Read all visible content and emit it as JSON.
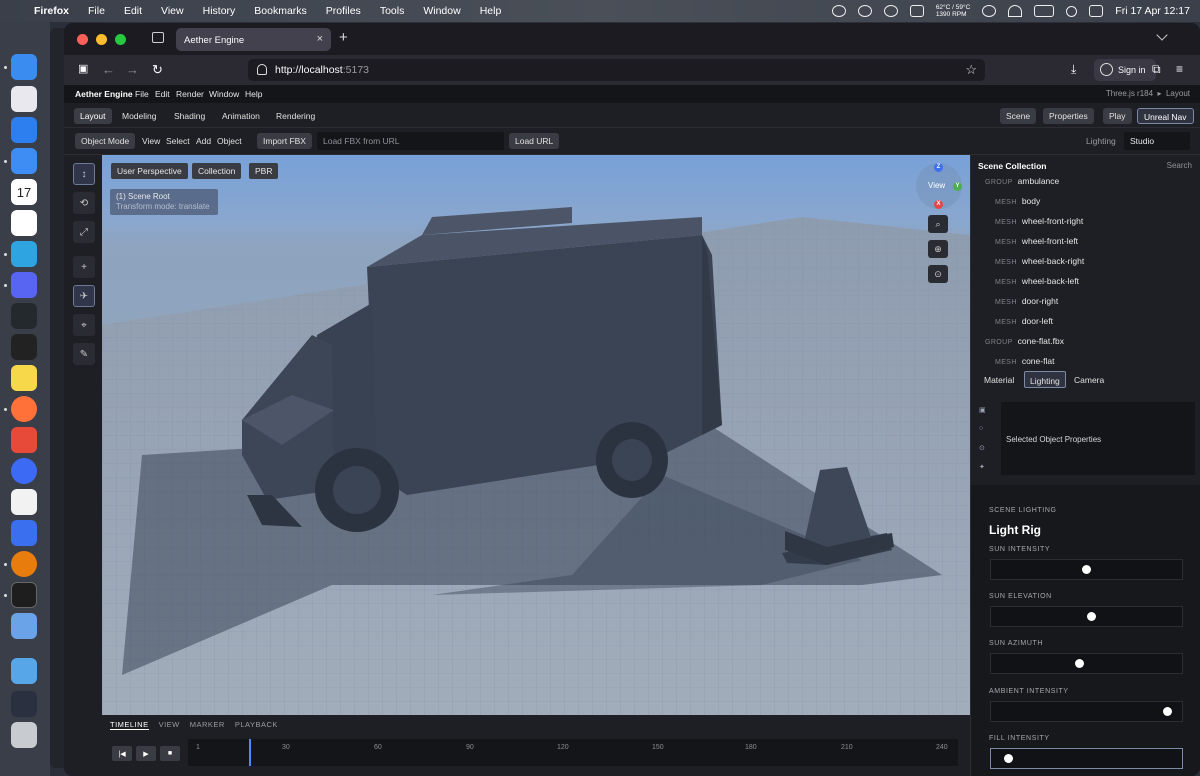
{
  "macos": {
    "app_name": "Firefox",
    "menus": [
      "File",
      "Edit",
      "View",
      "History",
      "Bookmarks",
      "Profiles",
      "Tools",
      "Window",
      "Help"
    ],
    "temps_line1": "62°C / 59°C",
    "temps_line2": "1390 RPM",
    "datetime": "Fri 17 Apr  12:17",
    "dock_calendar_day": "17"
  },
  "browser": {
    "tab_title": "Aether Engine",
    "url_host": "http://localhost",
    "url_port": ":5173",
    "sign_in_label": "Sign in"
  },
  "app": {
    "name": "Aether Engine",
    "menus": [
      "File",
      "Edit",
      "Render",
      "Window",
      "Help"
    ],
    "version": "Three.js r184",
    "layout_crumb": "Layout",
    "workspace_tabs": [
      "Layout",
      "Modeling",
      "Shading",
      "Animation",
      "Rendering"
    ],
    "active_workspace": "Layout",
    "right_buttons": [
      "Scene",
      "Properties",
      "Play",
      "Unreal Nav"
    ],
    "toolbar": {
      "object_mode": "Object Mode",
      "menus": [
        "View",
        "Select",
        "Add",
        "Object"
      ],
      "import_label": "Import FBX",
      "url_placeholder": "Load FBX from URL",
      "load_url_label": "Load URL",
      "lighting_label": "Lighting",
      "lighting_value": "Studio"
    },
    "tools": [
      "↕",
      "⟲",
      "⤢",
      "+",
      "✈",
      "⌖",
      "✎"
    ],
    "viewport": {
      "buttons": [
        "User Perspective",
        "Collection",
        "PBR"
      ],
      "info_title": "(1) Scene Root",
      "info_sub": "Transform mode: translate",
      "gizmo_label": "View",
      "axes": [
        "Z",
        "Y",
        "X"
      ]
    },
    "timeline": {
      "tabs": [
        "TIMELINE",
        "VIEW",
        "MARKER",
        "PLAYBACK"
      ],
      "controls": [
        "|◀",
        "▶",
        "■"
      ],
      "ticks": [
        "1",
        "30",
        "60",
        "90",
        "120",
        "150",
        "180",
        "210",
        "240"
      ]
    },
    "outliner": {
      "title": "Scene Collection",
      "search": "Search",
      "items": [
        {
          "kind": "GROUP",
          "name": "ambulance"
        },
        {
          "kind": "MESH",
          "name": "body"
        },
        {
          "kind": "MESH",
          "name": "wheel-front-right"
        },
        {
          "kind": "MESH",
          "name": "wheel-front-left"
        },
        {
          "kind": "MESH",
          "name": "wheel-back-right"
        },
        {
          "kind": "MESH",
          "name": "wheel-back-left"
        },
        {
          "kind": "MESH",
          "name": "door-right"
        },
        {
          "kind": "MESH",
          "name": "door-left"
        },
        {
          "kind": "GROUP",
          "name": "cone-flat.fbx"
        },
        {
          "kind": "MESH",
          "name": "cone-flat"
        }
      ]
    },
    "properties": {
      "tabs": [
        "Material",
        "Lighting",
        "Camera"
      ],
      "active_tab": "Lighting",
      "selected_text": "Selected Object Properties",
      "section": "SCENE LIGHTING",
      "rig_title": "Light Rig",
      "sliders": [
        {
          "label": "SUN INTENSITY",
          "value": 0.48
        },
        {
          "label": "SUN ELEVATION",
          "value": 0.51
        },
        {
          "label": "SUN AZIMUTH",
          "value": 0.44
        },
        {
          "label": "AMBIENT INTENSITY",
          "value": 0.94
        },
        {
          "label": "FILL INTENSITY",
          "value": 0.04
        }
      ]
    }
  },
  "colors": {
    "accent": "#4a8cff",
    "active_outline": "#7d8aa6"
  }
}
